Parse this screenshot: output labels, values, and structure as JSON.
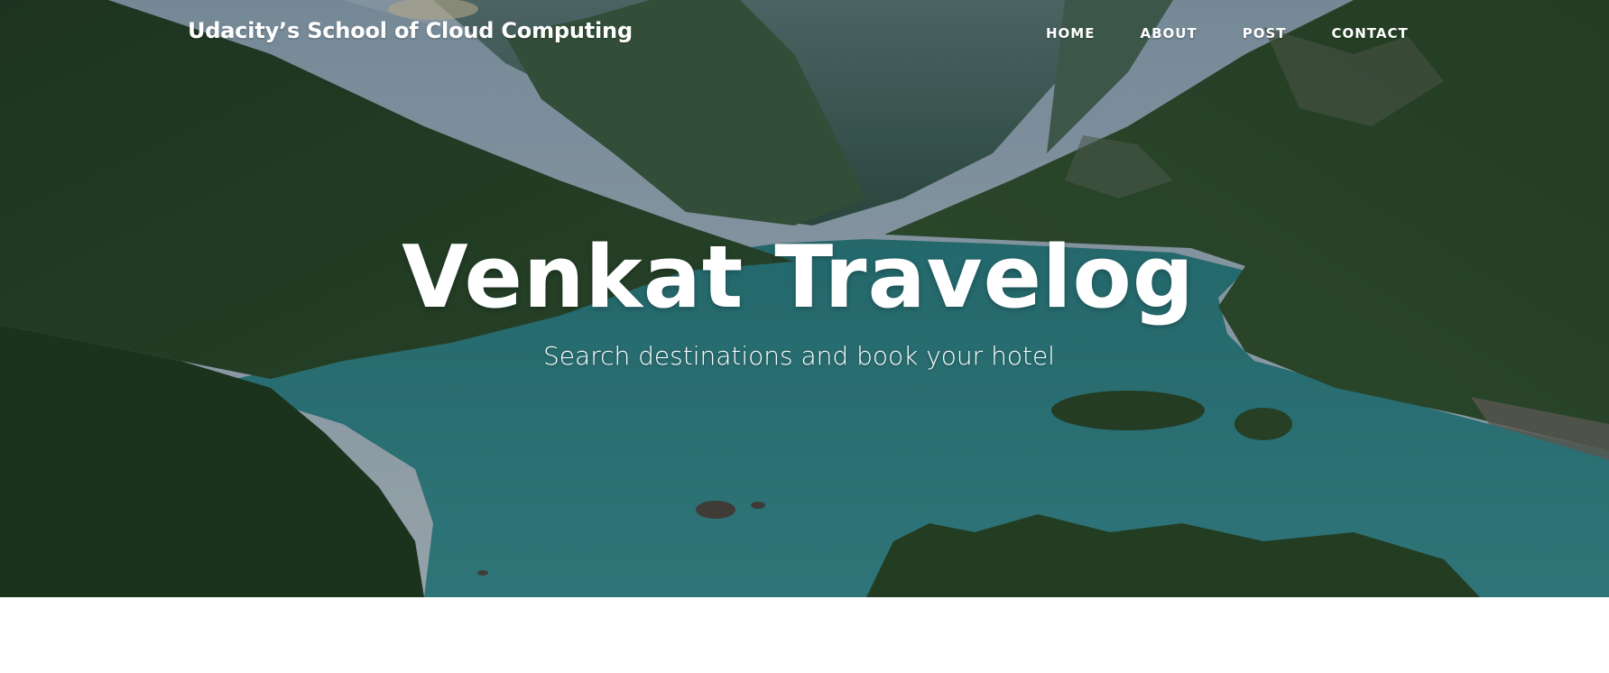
{
  "navbar": {
    "brand": "Udacity’s School of Cloud Computing",
    "links": {
      "home": "HOME",
      "about": "ABOUT",
      "post": "POST",
      "contact": "CONTACT"
    }
  },
  "hero": {
    "title": "Venkat Travelog",
    "subtitle": "Search destinations and book your hotel",
    "background_image": "mountain-lake-photo"
  },
  "colors": {
    "lake": "#2f8386",
    "forest": "#2b4a2e",
    "page_background": "#ffffff",
    "text": "#ffffff"
  }
}
